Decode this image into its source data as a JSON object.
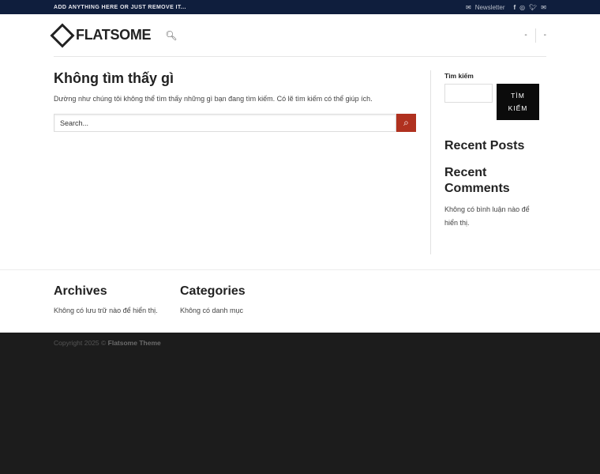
{
  "topbar": {
    "message": "ADD ANYTHING HERE OR JUST REMOVE IT...",
    "newsletter": "Newsletter",
    "social": [
      "facebook",
      "instagram",
      "twitter",
      "email"
    ]
  },
  "header": {
    "logo": "FLATSOME",
    "right_items": [
      "-",
      "-"
    ]
  },
  "main": {
    "title": "Không tìm thấy gì",
    "description": "Dường như chúng tôi không thể tìm thấy những gì bạn đang tìm kiếm. Có lẽ tìm kiếm có thể giúp ích.",
    "search_placeholder": "Search..."
  },
  "sidebar": {
    "search_label": "Tìm kiếm",
    "search_button_line1": "TÌM",
    "search_button_line2": "KIẾM",
    "recent_posts": "Recent Posts",
    "recent_comments": "Recent Comments",
    "no_comments": "Không có bình luận nào để hiển thị."
  },
  "footer": {
    "archives_title": "Archives",
    "archives_text": "Không có lưu trữ nào để hiển thị.",
    "categories_title": "Categories",
    "categories_text": "Không có danh mục",
    "copyright": "Copyright 2025 ©",
    "theme": "Flatsome Theme"
  },
  "colors": {
    "topbar": "#0f1e3d",
    "accent": "#b0311f",
    "footer": "#1c1c1c"
  }
}
